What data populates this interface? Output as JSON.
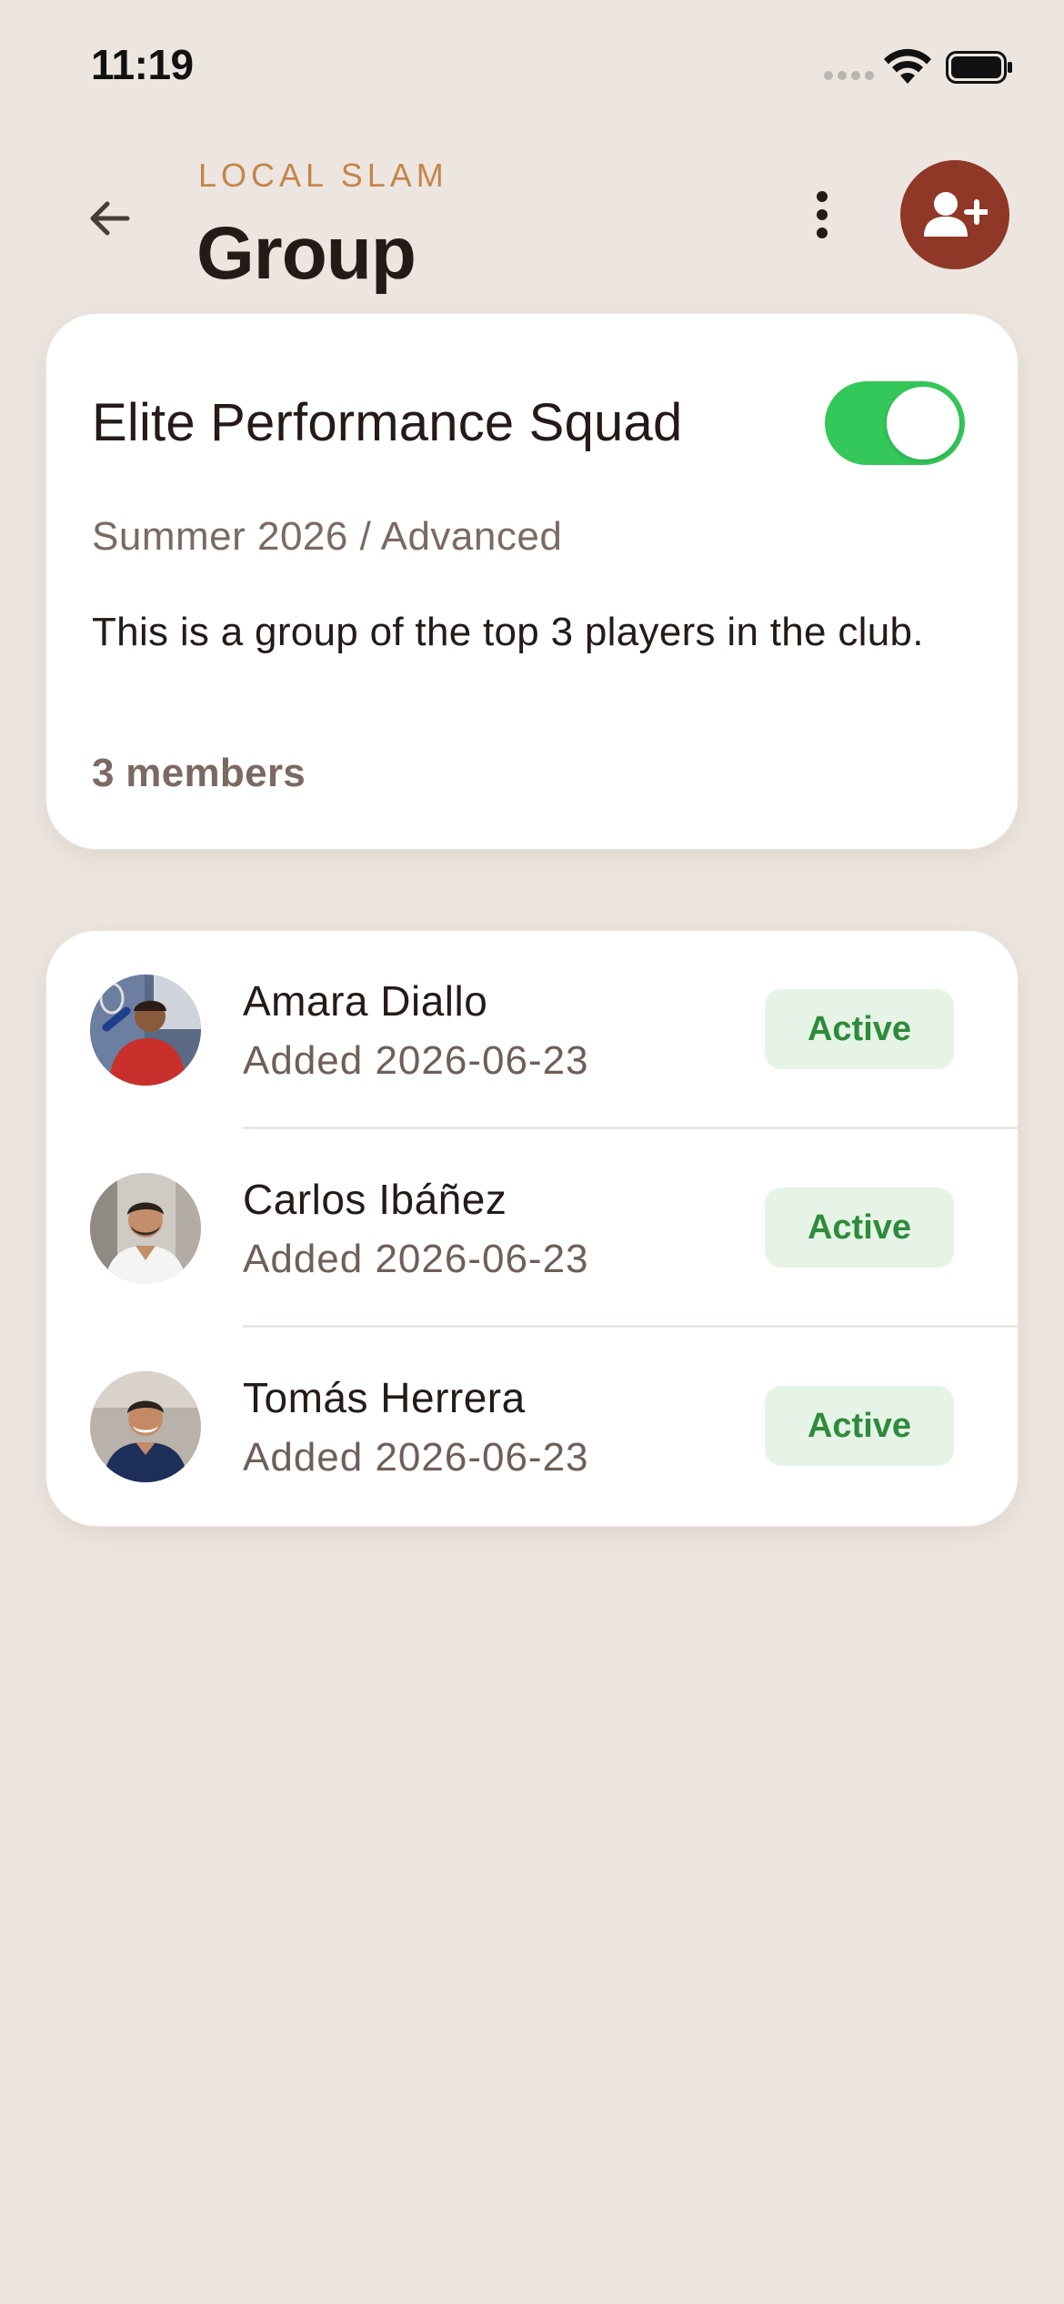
{
  "status_bar": {
    "time": "11:19"
  },
  "header": {
    "eyebrow": "LOCAL SLAM",
    "title": "Group"
  },
  "group": {
    "name": "Elite Performance Squad",
    "active_toggle": true,
    "subtitle": "Summer 2026 / Advanced",
    "description": "This is a group of the top 3 players in the club.",
    "members_count": "3 members"
  },
  "members": [
    {
      "name": "Amara Diallo",
      "added": "Added 2026-06-23",
      "status": "Active"
    },
    {
      "name": "Carlos Ibáñez",
      "added": "Added 2026-06-23",
      "status": "Active"
    },
    {
      "name": "Tomás Herrera",
      "added": "Added 2026-06-23",
      "status": "Active"
    }
  ],
  "icons": {
    "back": "arrow-left-icon",
    "more": "more-vertical-icon",
    "add_member": "user-plus-icon",
    "wifi": "wifi-icon",
    "battery": "battery-icon"
  },
  "colors": {
    "background": "#ede6e0",
    "accent": "#8f3827",
    "eyebrow": "#c4864a",
    "toggle_on": "#34c759",
    "badge_bg": "#e6f4e7",
    "badge_text": "#2e8b3b"
  }
}
